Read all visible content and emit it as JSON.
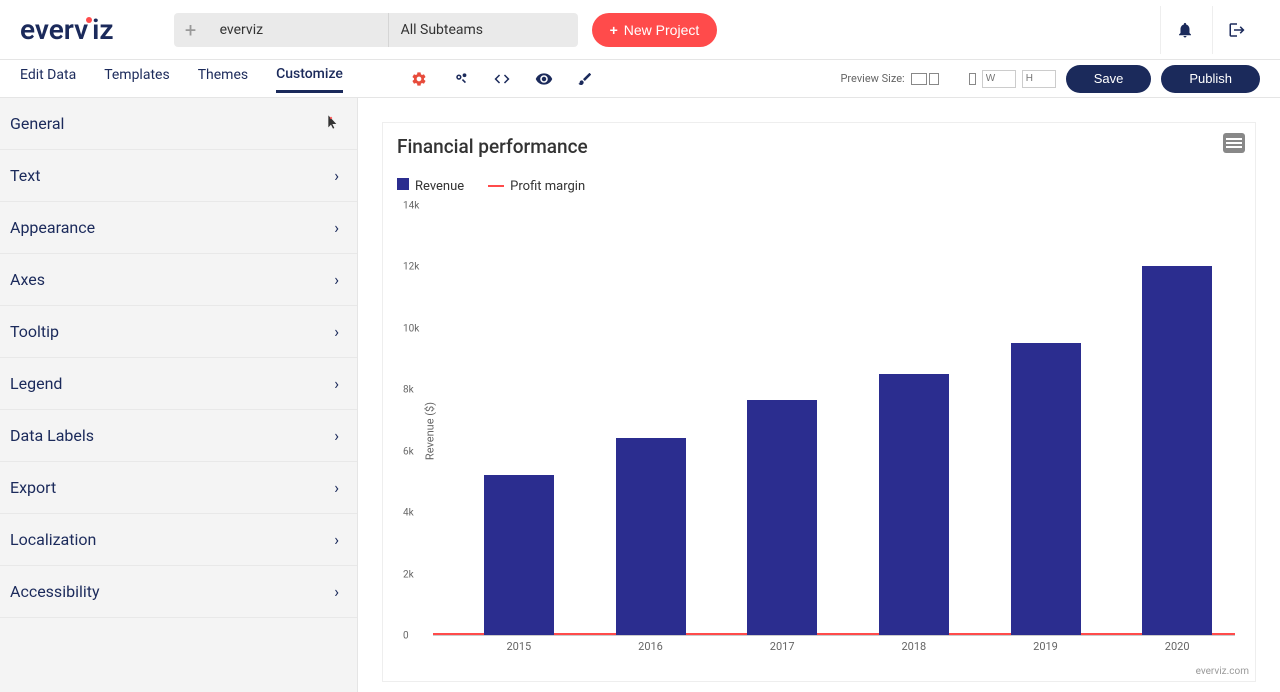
{
  "logo_text": "everviz",
  "team_main": "everviz",
  "team_sub": "All Subteams",
  "new_project_label": "New Project",
  "tabs": {
    "edit_data": "Edit Data",
    "templates": "Templates",
    "themes": "Themes",
    "customize": "Customize"
  },
  "preview_label": "Preview Size:",
  "preview_w_placeholder": "W",
  "preview_h_placeholder": "H",
  "save_label": "Save",
  "publish_label": "Publish",
  "sidebar": {
    "general": "General",
    "text": "Text",
    "appearance": "Appearance",
    "axes": "Axes",
    "tooltip": "Tooltip",
    "legend": "Legend",
    "data_labels": "Data Labels",
    "export": "Export",
    "localization": "Localization",
    "accessibility": "Accessibility"
  },
  "chart_title": "Financial performance",
  "legend_revenue": "Revenue",
  "legend_profit": "Profit margin",
  "credit": "everviz.com",
  "chart_data": {
    "type": "bar",
    "title": "Financial performance",
    "ylabel": "Revenue ($)",
    "xlabel": "",
    "ylim": [
      0,
      14000
    ],
    "yticks": [
      "0",
      "2k",
      "4k",
      "6k",
      "8k",
      "10k",
      "12k",
      "14k"
    ],
    "categories": [
      "2015",
      "2016",
      "2017",
      "2018",
      "2019",
      "2020"
    ],
    "series": [
      {
        "name": "Revenue",
        "type": "bar",
        "color": "#2b2d8f",
        "values": [
          5200,
          6400,
          7650,
          8500,
          9500,
          12000
        ]
      },
      {
        "name": "Profit margin",
        "type": "line",
        "color": "#ff4b4b",
        "values": [
          0,
          0,
          0,
          0,
          0,
          0
        ]
      }
    ]
  }
}
